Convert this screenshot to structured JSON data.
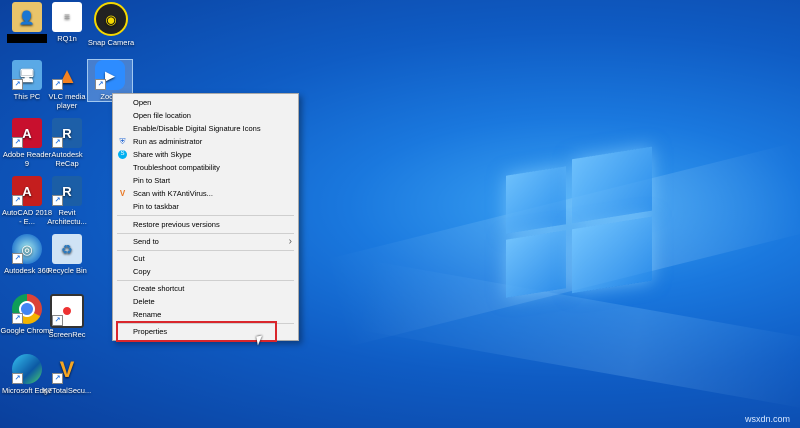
{
  "desktop": {
    "icons": [
      {
        "label": "",
        "glyph": "user-folder"
      },
      {
        "label": "RQ1n",
        "glyph": "document"
      },
      {
        "label": "Snap Camera",
        "glyph": "snap-camera"
      },
      {
        "label": "This PC",
        "glyph": "computer"
      },
      {
        "label": "VLC media player",
        "glyph": "vlc-cone"
      },
      {
        "label": "Zoom",
        "glyph": "zoom-camera"
      },
      {
        "label": "Adobe Reader 9",
        "glyph": "adobe-reader"
      },
      {
        "label": "Autodesk ReCap",
        "glyph": "autodesk-recap"
      },
      {
        "label": "AutoCAD 2018 - E...",
        "glyph": "autocad"
      },
      {
        "label": "Revit Architectu...",
        "glyph": "revit"
      },
      {
        "label": "Autodesk 360",
        "glyph": "autodesk-360"
      },
      {
        "label": "Recycle Bin",
        "glyph": "recycle-bin"
      },
      {
        "label": "Google Chrome",
        "glyph": "chrome"
      },
      {
        "label": "ScreenRec",
        "glyph": "screenrec"
      },
      {
        "label": "Microsoft Edge",
        "glyph": "edge"
      },
      {
        "label": "K7TotalSecu...",
        "glyph": "k7-security"
      }
    ]
  },
  "menu": {
    "items": [
      {
        "label": "Open"
      },
      {
        "label": "Open file location"
      },
      {
        "label": "Enable/Disable Digital Signature Icons"
      },
      {
        "label": "Run as administrator",
        "icon": "shield-icon"
      },
      {
        "label": "Share with Skype",
        "icon": "skype-icon"
      },
      {
        "label": "Troubleshoot compatibility"
      },
      {
        "label": "Pin to Start"
      },
      {
        "label": "Scan with K7AntiVirus...",
        "icon": "k7-icon"
      },
      {
        "label": "Pin to taskbar"
      },
      {
        "label": "Restore previous versions"
      },
      {
        "label": "Send to"
      },
      {
        "label": "Cut"
      },
      {
        "label": "Copy"
      },
      {
        "label": "Create shortcut"
      },
      {
        "label": "Delete"
      },
      {
        "label": "Rename"
      },
      {
        "label": "Properties"
      }
    ]
  },
  "colors": {
    "highlight_border": "#d9262c",
    "desktop_blue": "#0f5cc4"
  },
  "watermark": "wsxdn.com"
}
